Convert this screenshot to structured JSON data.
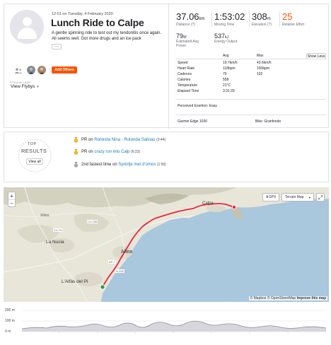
{
  "activity": {
    "date": "12:01 on Tuesday, 4 February 2020",
    "title": "Lunch Ride to Calpe",
    "description": "A gentle spinning ride to test out my tendonitis once again. All seems well. Got more drugs and an ice pack",
    "more_label": "...",
    "add_others_label": "Add Others",
    "strava_labs_label": "STRAVA LABS",
    "view_flybys_label": "View Flybys",
    "view_flybys_chevron": "›"
  },
  "stats": {
    "distance_value": "37.06",
    "distance_unit": "km",
    "distance_label": "Distance",
    "distance_help": "(?)",
    "moving_time_value": "1:53:02",
    "moving_time_label": "Moving Time",
    "elevation_value": "308",
    "elevation_unit": "m",
    "elevation_label": "Elevation",
    "elevation_help": "(?)",
    "relative_effort_value": "25",
    "relative_effort_label": "Relative Effort",
    "power_value": "79",
    "power_unit": "W",
    "power_label_1": "Estimated Avg",
    "power_label_2": "Power",
    "energy_value": "537",
    "energy_unit": "kJ",
    "energy_label": "Energy Output",
    "show_less_label": "Show Less",
    "avg_header": "Avg",
    "max_header": "Max",
    "rows": [
      {
        "label": "Speed",
        "avg": "19.7km/h",
        "max": "43.6km/h"
      },
      {
        "label": "Heart Rate",
        "avg": "118bpm",
        "max": "150bpm"
      },
      {
        "label": "Cadence",
        "avg": "75",
        "max": "102"
      },
      {
        "label": "Calories",
        "avg": "558",
        "max": ""
      },
      {
        "label": "Temperature",
        "avg": "21°C",
        "max": ""
      },
      {
        "label": "Elapsed Time",
        "avg": "3:31:29",
        "max": ""
      }
    ],
    "perceived_label": "Perceived Exertion:",
    "perceived_value": "Easy",
    "device": "Garmin Edge 1030",
    "bike_label": "Bike:",
    "bike_value": "Granfondo"
  },
  "results": {
    "badge_top": "TOP",
    "badge_title": "RESULTS",
    "view_all_label": "View all",
    "items": [
      {
        "prefix": "PR on",
        "segment": "Rotonda Nina - Rotonda Salinas",
        "time": "(3:44)"
      },
      {
        "prefix": "PR on",
        "segment": "crazy run into Calp",
        "time": "(6:23)"
      },
      {
        "prefix": "2nd fastest time on",
        "segment": "Sprintje met d'omos",
        "time": "(1:50)"
      }
    ]
  },
  "map": {
    "zoom_in": "+",
    "zoom_out": "−",
    "gpx_label": "GPX",
    "layer_label": "Terrain Map",
    "fullscreen_icon": "⤢",
    "places": [
      "Calpe",
      "Xirles",
      "La Nucia",
      "Altea",
      "L'Alfàs del Pi",
      "CV-755",
      "CV-70",
      "AP-7",
      "N-332"
    ],
    "attribution_mapbox": "© Mapbox",
    "attribution_osm": "© OpenStreetMap",
    "attribution_improve": "Improve this map",
    "colors": {
      "water": "#a9c7dd",
      "land": "#e8e6d9",
      "route": "#e8283c",
      "start": "#2e9e3e"
    }
  },
  "elevation": {
    "y_labels": [
      "200 m",
      "100 m",
      "0 m"
    ]
  }
}
